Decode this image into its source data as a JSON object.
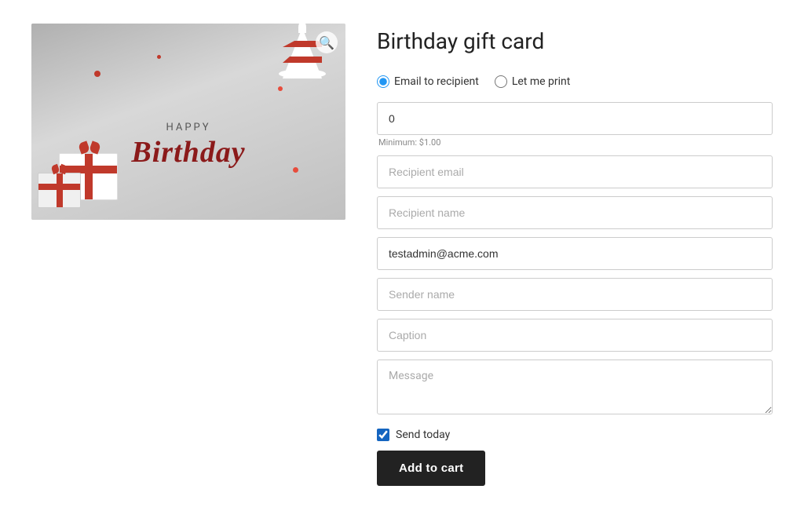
{
  "page": {
    "title": "Birthday gift card"
  },
  "image": {
    "alt": "Birthday gift card image",
    "zoom_icon": "🔍",
    "happy_text": "HAPPY",
    "birthday_text": "Birthday"
  },
  "delivery": {
    "email_label": "Email to recipient",
    "print_label": "Let me print",
    "email_selected": true
  },
  "form": {
    "amount": {
      "value": "0",
      "min_label": "Minimum: $1.00"
    },
    "recipient_email": {
      "placeholder": "Recipient email"
    },
    "recipient_name": {
      "placeholder": "Recipient name"
    },
    "sender_email": {
      "value": "testadmin@acme.com"
    },
    "sender_name": {
      "placeholder": "Sender name"
    },
    "caption": {
      "placeholder": "Caption"
    },
    "message": {
      "placeholder": "Message"
    },
    "send_today": {
      "label": "Send today",
      "checked": true
    },
    "add_to_cart": {
      "label": "Add to cart"
    }
  }
}
